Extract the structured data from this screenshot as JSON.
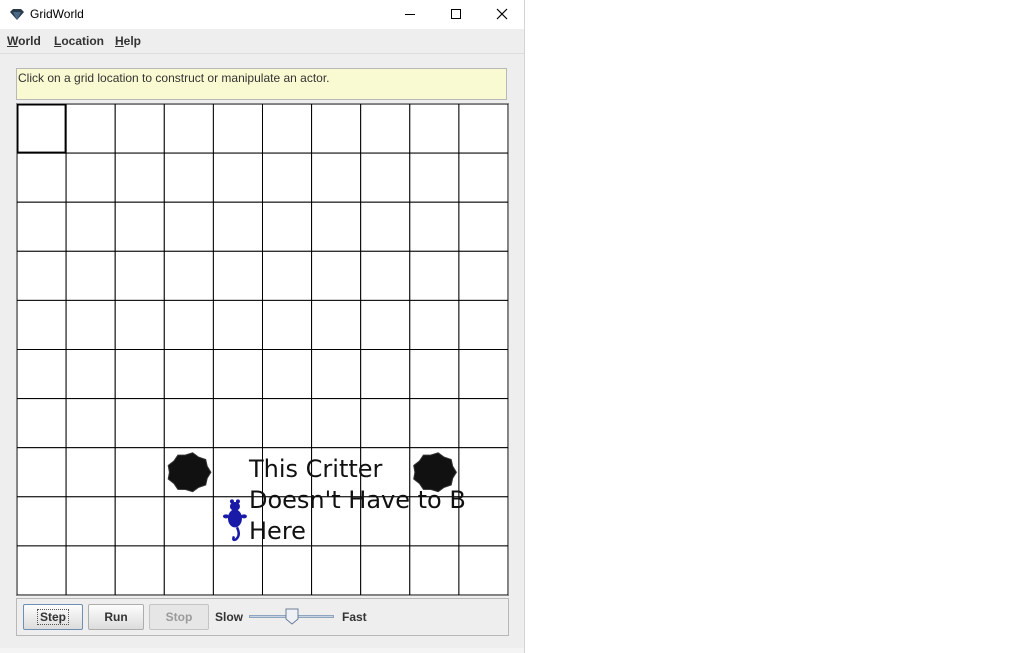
{
  "window": {
    "title": "GridWorld",
    "app_icon": "gridworld-diamond-icon",
    "controls": [
      "minimize-icon",
      "maximize-icon",
      "close-icon"
    ]
  },
  "menubar": {
    "items": [
      {
        "label": "World",
        "mnemonic": "W"
      },
      {
        "label": "Location",
        "mnemonic": "L"
      },
      {
        "label": "Help",
        "mnemonic": "H"
      }
    ]
  },
  "message": {
    "text": "Click on a grid location to construct or manipulate an actor."
  },
  "grid": {
    "rows": 10,
    "cols": 10,
    "selected_cell": [
      0,
      0
    ],
    "actors": [
      {
        "type": "rock",
        "row": 7,
        "col": 3,
        "color": "#111111"
      },
      {
        "type": "rock",
        "row": 7,
        "col": 8,
        "color": "#111111"
      },
      {
        "type": "critter",
        "row": 8,
        "col": 4,
        "color": "#1a1aa8"
      }
    ],
    "annotation": "This Critter Doesn't Have to Be Here"
  },
  "controls": {
    "step_label": "Step",
    "run_label": "Run",
    "stop_label": "Stop",
    "slow_label": "Slow",
    "fast_label": "Fast",
    "speed_fraction": 0.5
  },
  "colors": {
    "message_bg": "#fafad2",
    "grid_line": "#000000",
    "window_bg": "#eeeeee"
  }
}
